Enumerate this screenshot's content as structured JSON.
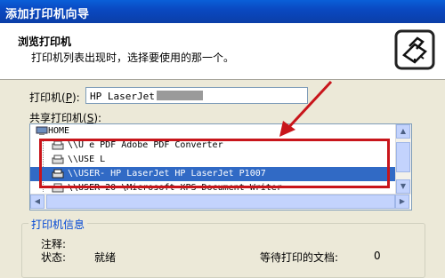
{
  "window": {
    "title": "添加打印机向导"
  },
  "header": {
    "title": "浏览打印机",
    "subtitle": "打印机列表出现时，选择要使用的那一个。",
    "icon": "printer-wizard-icon"
  },
  "printer_field": {
    "label_prefix": "打印机(",
    "label_key": "P",
    "label_suffix": "):",
    "value": "HP LaserJet"
  },
  "shared_list": {
    "label_prefix": "共享打印机(",
    "label_key": "S",
    "label_suffix": "):",
    "root": "HOME",
    "items": [
      {
        "text": "\\\\U                e PDF   Adobe PDF Converter",
        "selected": false
      },
      {
        "text": "\\\\USE                                       L",
        "selected": false
      },
      {
        "text": "\\\\USER-              HP LaserJet  HP LaserJet P1007",
        "selected": true
      },
      {
        "text": "\\\\USER-20              \\Microsoft XPS Document Writer",
        "selected": false
      }
    ]
  },
  "info": {
    "group_title": "打印机信息",
    "comment_label": "注释:",
    "status_label": "状态:",
    "status_value": "就绪",
    "queue_label": "等待打印的文档:",
    "queue_value": "0"
  },
  "colors": {
    "title_bar": "#0b4fc8",
    "selection": "#316ac5",
    "annotation": "#c8151b"
  }
}
